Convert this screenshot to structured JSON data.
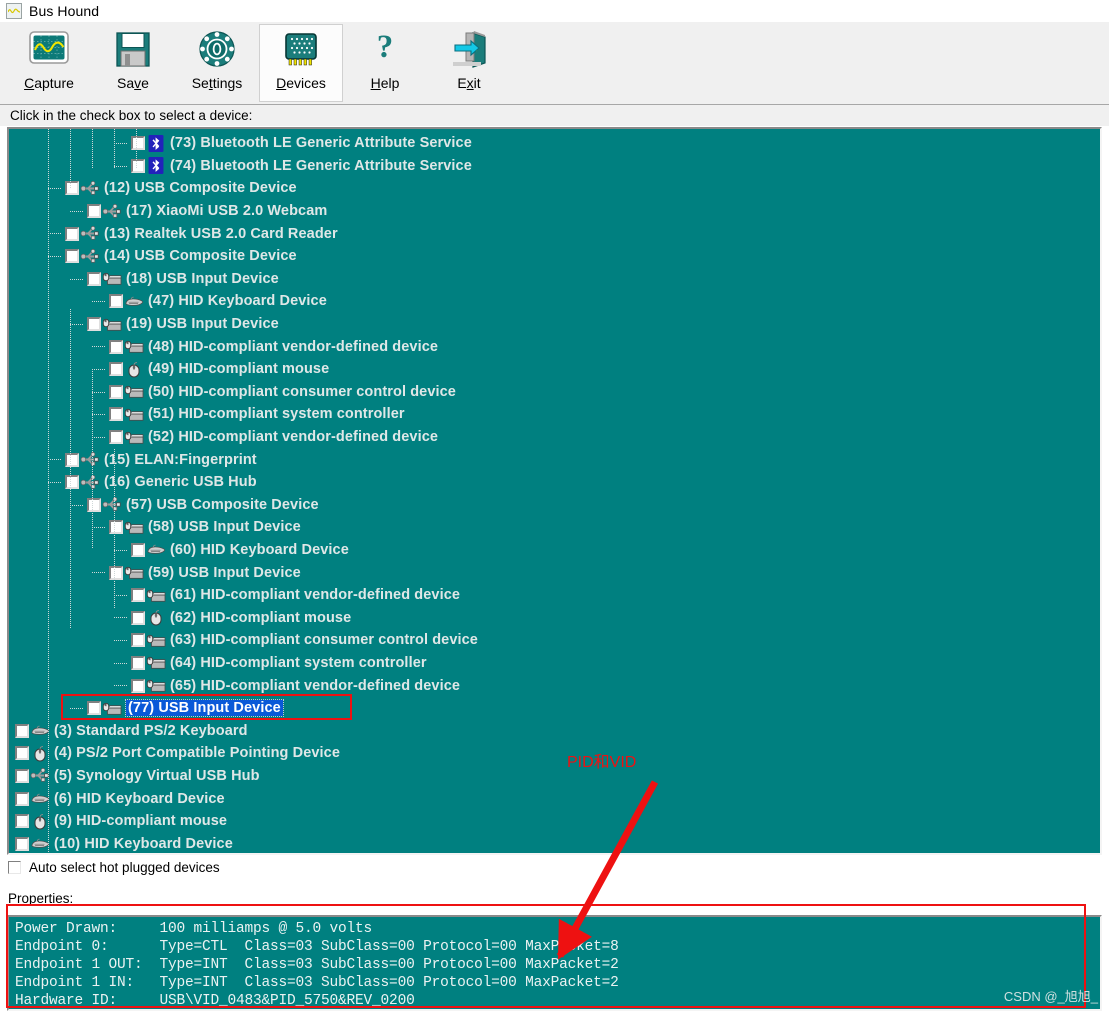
{
  "window": {
    "title": "Bus Hound",
    "app_icon": "waveform-icon"
  },
  "toolbar": {
    "buttons": [
      {
        "label": "Capture",
        "accel": "C",
        "icon": "oscilloscope-icon",
        "selected": false
      },
      {
        "label": "Save",
        "accel": "v",
        "icon": "floppy-disk-icon",
        "selected": false
      },
      {
        "label": "Settings",
        "accel": "t",
        "icon": "gear-dial-icon",
        "selected": false
      },
      {
        "label": "Devices",
        "accel": "D",
        "icon": "chip-icon",
        "selected": true
      },
      {
        "label": "Help",
        "accel": "H",
        "icon": "question-mark-icon",
        "selected": false
      },
      {
        "label": "Exit",
        "accel": "x",
        "icon": "exit-door-icon",
        "selected": false
      }
    ]
  },
  "hint": "Click in the check box to select a device:",
  "tree": {
    "rows": [
      {
        "indent": 5,
        "icon": "bluetooth-icon",
        "label": "(73) Bluetooth LE Generic Attribute Service",
        "checked": false,
        "selected": false
      },
      {
        "indent": 5,
        "icon": "bluetooth-icon",
        "label": "(74) Bluetooth LE Generic Attribute Service",
        "checked": false,
        "selected": false
      },
      {
        "indent": 2,
        "icon": "usb-icon",
        "label": "(12) USB Composite Device",
        "checked": false,
        "selected": false
      },
      {
        "indent": 3,
        "icon": "usb-icon",
        "label": "(17) XiaoMi USB 2.0 Webcam",
        "checked": false,
        "selected": false
      },
      {
        "indent": 2,
        "icon": "usb-icon",
        "label": "(13) Realtek USB 2.0 Card Reader",
        "checked": false,
        "selected": false
      },
      {
        "indent": 2,
        "icon": "usb-icon",
        "label": "(14) USB Composite Device",
        "checked": false,
        "selected": false
      },
      {
        "indent": 3,
        "icon": "hid-device-icon",
        "label": "(18) USB Input Device",
        "checked": false,
        "selected": false
      },
      {
        "indent": 4,
        "icon": "keyboard-icon",
        "label": "(47) HID Keyboard Device",
        "checked": false,
        "selected": false
      },
      {
        "indent": 3,
        "icon": "hid-device-icon",
        "label": "(19) USB Input Device",
        "checked": false,
        "selected": false
      },
      {
        "indent": 4,
        "icon": "hid-device-icon",
        "label": "(48) HID-compliant vendor-defined device",
        "checked": false,
        "selected": false
      },
      {
        "indent": 4,
        "icon": "mouse-icon",
        "label": "(49) HID-compliant mouse",
        "checked": false,
        "selected": false
      },
      {
        "indent": 4,
        "icon": "hid-device-icon",
        "label": "(50) HID-compliant consumer control device",
        "checked": false,
        "selected": false
      },
      {
        "indent": 4,
        "icon": "hid-device-icon",
        "label": "(51) HID-compliant system controller",
        "checked": false,
        "selected": false
      },
      {
        "indent": 4,
        "icon": "hid-device-icon",
        "label": "(52) HID-compliant vendor-defined device",
        "checked": false,
        "selected": false
      },
      {
        "indent": 2,
        "icon": "usb-icon",
        "label": "(15) ELAN:Fingerprint",
        "checked": false,
        "selected": false
      },
      {
        "indent": 2,
        "icon": "usb-icon",
        "label": "(16) Generic USB Hub",
        "checked": false,
        "selected": false
      },
      {
        "indent": 3,
        "icon": "usb-icon",
        "label": "(57) USB Composite Device",
        "checked": false,
        "selected": false
      },
      {
        "indent": 4,
        "icon": "hid-device-icon",
        "label": "(58) USB Input Device",
        "checked": false,
        "selected": false
      },
      {
        "indent": 5,
        "icon": "keyboard-icon",
        "label": "(60) HID Keyboard Device",
        "checked": false,
        "selected": false
      },
      {
        "indent": 4,
        "icon": "hid-device-icon",
        "label": "(59) USB Input Device",
        "checked": false,
        "selected": false
      },
      {
        "indent": 5,
        "icon": "hid-device-icon",
        "label": "(61) HID-compliant vendor-defined device",
        "checked": false,
        "selected": false
      },
      {
        "indent": 5,
        "icon": "mouse-icon",
        "label": "(62) HID-compliant mouse",
        "checked": false,
        "selected": false
      },
      {
        "indent": 5,
        "icon": "hid-device-icon",
        "label": "(63) HID-compliant consumer control device",
        "checked": false,
        "selected": false
      },
      {
        "indent": 5,
        "icon": "hid-device-icon",
        "label": "(64) HID-compliant system controller",
        "checked": false,
        "selected": false
      },
      {
        "indent": 5,
        "icon": "hid-device-icon",
        "label": "(65) HID-compliant vendor-defined device",
        "checked": false,
        "selected": false
      },
      {
        "indent": 3,
        "icon": "hid-device-icon",
        "label": "(77) USB Input Device",
        "checked": false,
        "selected": true
      },
      {
        "indent": 0,
        "icon": "keyboard-icon",
        "label": "(3) Standard PS/2 Keyboard",
        "checked": false,
        "selected": false
      },
      {
        "indent": 0,
        "icon": "mouse-icon",
        "label": "(4) PS/2 Port Compatible Pointing Device",
        "checked": false,
        "selected": false
      },
      {
        "indent": 0,
        "icon": "usb-icon",
        "label": "(5) Synology Virtual USB Hub",
        "checked": false,
        "selected": false
      },
      {
        "indent": 0,
        "icon": "keyboard-icon",
        "label": "(6) HID Keyboard Device",
        "checked": false,
        "selected": false
      },
      {
        "indent": 0,
        "icon": "mouse-icon",
        "label": "(9) HID-compliant mouse",
        "checked": false,
        "selected": false
      },
      {
        "indent": 0,
        "icon": "keyboard-icon",
        "label": "(10) HID Keyboard Device",
        "checked": false,
        "selected": false
      }
    ]
  },
  "auto_select": {
    "label": "Auto select hot plugged devices",
    "checked": false
  },
  "properties": {
    "label": "Properties:",
    "lines": [
      "Power Drawn:     100 milliamps @ 5.0 volts",
      "Endpoint 0:      Type=CTL  Class=03 SubClass=00 Protocol=00 MaxPacket=8",
      "Endpoint 1 OUT:  Type=INT  Class=03 SubClass=00 Protocol=00 MaxPacket=2",
      "Endpoint 1 IN:   Type=INT  Class=03 SubClass=00 Protocol=00 MaxPacket=2",
      "Hardware ID:     USB\\VID_0483&PID_5750&REV_0200"
    ]
  },
  "annotations": {
    "callout_text": "PID和VID",
    "color": "#ee1111"
  },
  "watermark": "CSDN @_旭旭_",
  "colors": {
    "tree_background": "#008080",
    "selection": "#0a59d8",
    "annotation_red": "#ee1111",
    "toolbar_face": "#f0f0f0"
  }
}
